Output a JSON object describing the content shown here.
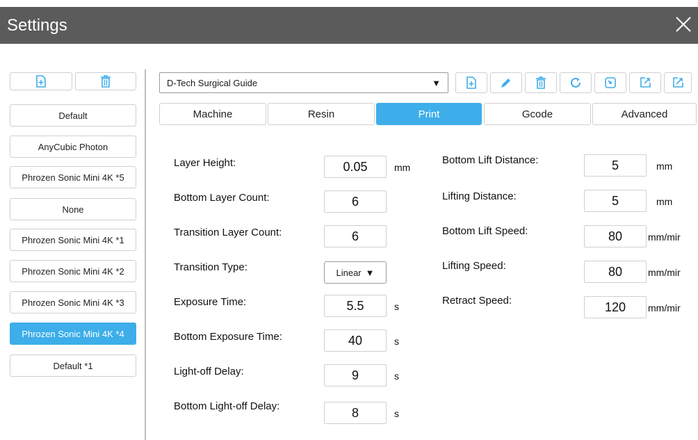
{
  "window": {
    "title": "Settings",
    "close_icon": "close-icon"
  },
  "presets": {
    "add_icon": "add-file-icon",
    "delete_icon": "trash-icon",
    "items": [
      {
        "label": "Default",
        "selected": false
      },
      {
        "label": "AnyCubic Photon",
        "selected": false
      },
      {
        "label": "Phrozen Sonic Mini 4K *5",
        "selected": false
      },
      {
        "label": "None",
        "selected": false
      },
      {
        "label": "Phrozen Sonic Mini 4K *1",
        "selected": false
      },
      {
        "label": "Phrozen Sonic Mini 4K *2",
        "selected": false
      },
      {
        "label": "Phrozen Sonic Mini 4K *3",
        "selected": false
      },
      {
        "label": "Phrozen Sonic Mini 4K *4",
        "selected": true
      },
      {
        "label": "Default *1",
        "selected": false
      }
    ]
  },
  "profile": {
    "selected": "D-Tech Surgical Guide",
    "toolbar_icons": [
      "add-file-icon",
      "pencil-icon",
      "trash-icon",
      "refresh-icon",
      "import-icon",
      "export-icon",
      "export-alt-icon"
    ]
  },
  "tabs": [
    {
      "label": "Machine",
      "active": false
    },
    {
      "label": "Resin",
      "active": false
    },
    {
      "label": "Print",
      "active": true
    },
    {
      "label": "Gcode",
      "active": false
    },
    {
      "label": "Advanced",
      "active": false
    }
  ],
  "accent_color": "#3daee9",
  "print": {
    "left": [
      {
        "label": "Layer Height:",
        "value": "0.05",
        "unit": "mm"
      },
      {
        "label": "Bottom Layer Count:",
        "value": "6",
        "unit": ""
      },
      {
        "label": "Transition Layer Count:",
        "value": "6",
        "unit": ""
      },
      {
        "label": "Transition Type:",
        "value": "Linear",
        "unit": ""
      },
      {
        "label": "Exposure Time:",
        "value": "5.5",
        "unit": "s"
      },
      {
        "label": "Bottom Exposure Time:",
        "value": "40",
        "unit": "s"
      },
      {
        "label": "Light-off Delay:",
        "value": "9",
        "unit": "s"
      },
      {
        "label": "Bottom Light-off Delay:",
        "value": "8",
        "unit": "s"
      }
    ],
    "right": [
      {
        "label": "Bottom Lift Distance:",
        "value": "5",
        "unit": "mm"
      },
      {
        "label": "Lifting Distance:",
        "value": "5",
        "unit": "mm"
      },
      {
        "label": "Bottom Lift Speed:",
        "value": "80",
        "unit": "mm/mir"
      },
      {
        "label": "Lifting Speed:",
        "value": "80",
        "unit": "mm/mir"
      },
      {
        "label": "Retract Speed:",
        "value": "120",
        "unit": "mm/mir"
      }
    ]
  }
}
